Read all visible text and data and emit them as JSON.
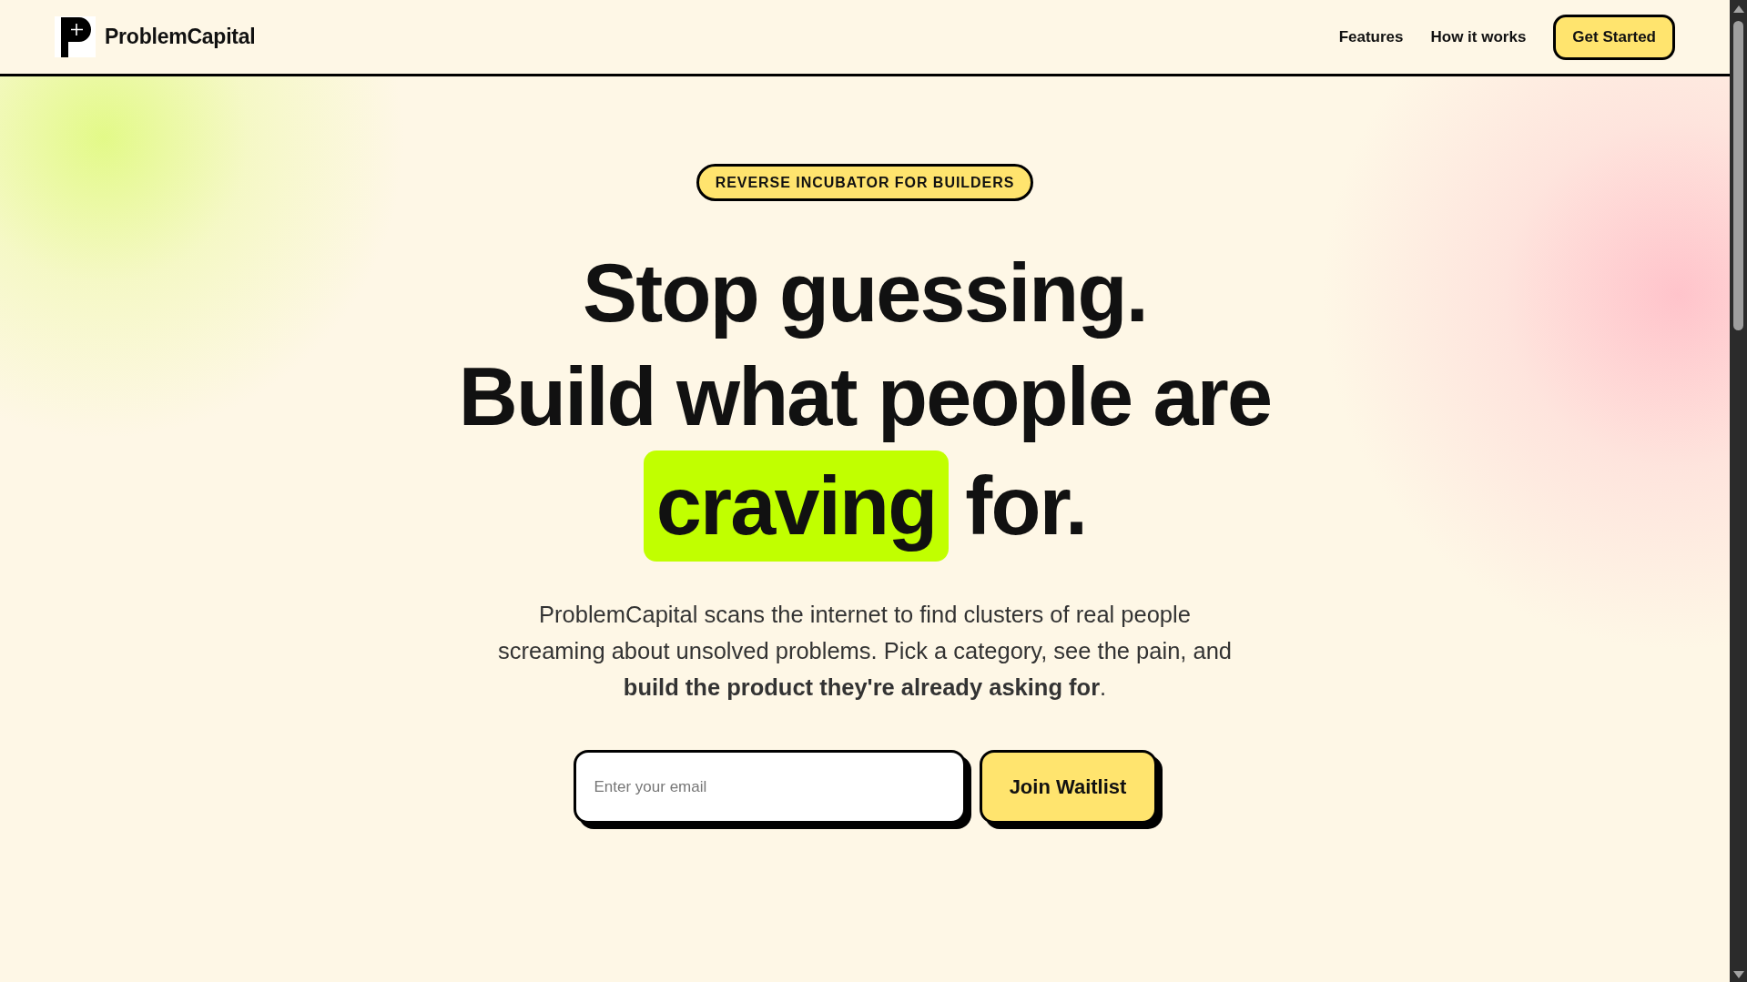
{
  "header": {
    "brand": "ProblemCapital",
    "nav": [
      {
        "label": "Features"
      },
      {
        "label": "How it works"
      }
    ],
    "cta": "Get Started"
  },
  "hero": {
    "badge": "REVERSE INCUBATOR FOR BUILDERS",
    "headline": [
      "Stop guessing.",
      "Build what people are"
    ],
    "highlight": "craving",
    "headline_tail": "for.",
    "description": "ProblemCapital scans the internet to find clusters of real people screaming about unsolved problems. Pick a category, see the pain, and **build the product they're already asking for**.",
    "email": {
      "placeholder": "Enter your email"
    },
    "submit": "Join Waitlist"
  }
}
